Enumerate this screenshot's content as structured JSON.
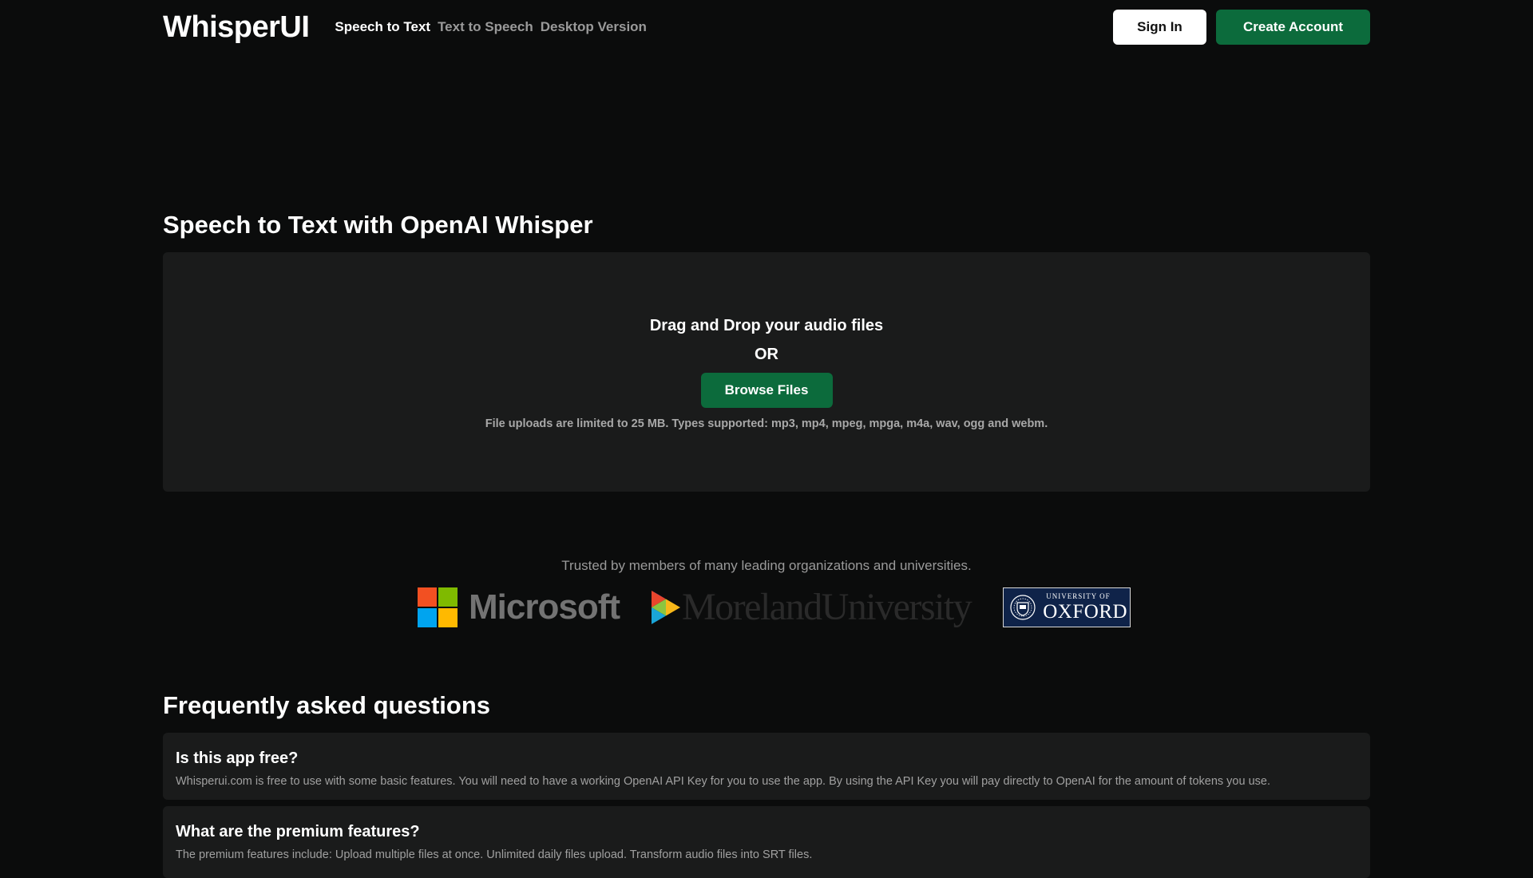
{
  "header": {
    "logo": "WhisperUI",
    "nav": [
      {
        "label": "Speech to Text",
        "active": true
      },
      {
        "label": "Text to Speech",
        "active": false
      },
      {
        "label": "Desktop Version",
        "active": false
      }
    ],
    "sign_in": "Sign In",
    "create_account": "Create Account"
  },
  "main": {
    "title": "Speech to Text with OpenAI Whisper",
    "upload": {
      "drop_text": "Drag and Drop your audio files",
      "or_text": "OR",
      "browse_label": "Browse Files",
      "note": "File uploads are limited to 25 MB. Types supported: mp3, mp4, mpeg, mpga, m4a, wav, ogg and webm."
    }
  },
  "trusted": {
    "text": "Trusted by members of many leading organizations and universities.",
    "logos": {
      "microsoft": "Microsoft",
      "moreland": "MorelandUniversity",
      "oxford_small": "UNIVERSITY OF",
      "oxford_big": "OXFORD"
    }
  },
  "faq": {
    "title": "Frequently asked questions",
    "items": [
      {
        "question": "Is this app free?",
        "answer": "Whisperui.com is free to use with some basic features. You will need to have a working OpenAI API Key for you to use the app. By using the API Key you will pay directly to OpenAI for the amount of tokens you use."
      },
      {
        "question": "What are the premium features?",
        "answer": "The premium features include: Upload multiple files at once. Unlimited daily files upload. Transform audio files into SRT files."
      }
    ]
  },
  "colors": {
    "background": "#0b0c0c",
    "panel": "#1a1b1b",
    "accent_green": "#0c6b3c",
    "ms_red": "#f25022",
    "ms_green": "#7fba00",
    "ms_blue": "#00a4ef",
    "ms_yellow": "#ffb900",
    "oxford_blue": "#0f2349"
  }
}
